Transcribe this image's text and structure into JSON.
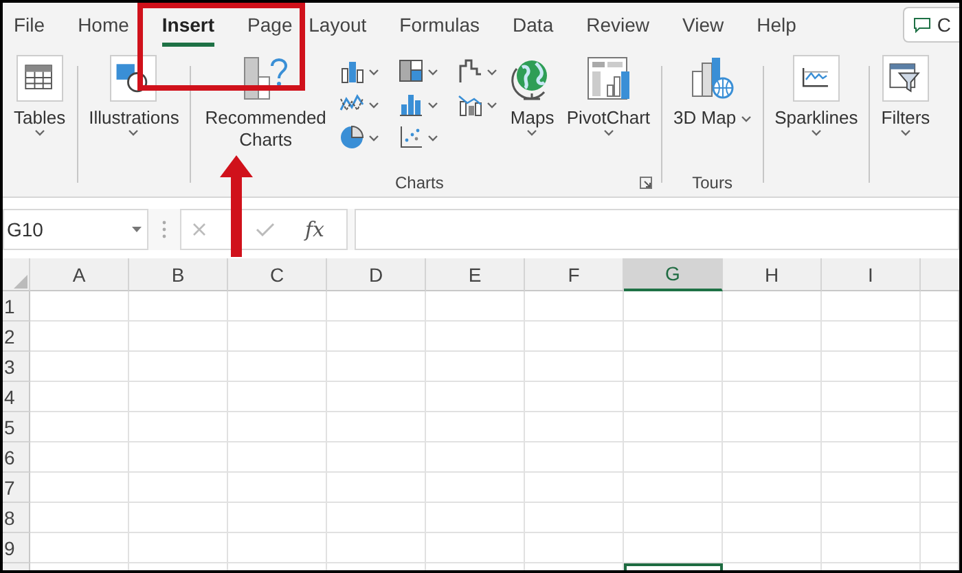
{
  "tabs": [
    {
      "label": "File",
      "selected": false
    },
    {
      "label": "Home",
      "selected": false
    },
    {
      "label": "Insert",
      "selected": true
    },
    {
      "label": "Page Layout",
      "selected": false
    },
    {
      "label": "Formulas",
      "selected": false
    },
    {
      "label": "Data",
      "selected": false
    },
    {
      "label": "Review",
      "selected": false
    },
    {
      "label": "View",
      "selected": false
    },
    {
      "label": "Help",
      "selected": false
    }
  ],
  "comments_button": {
    "label": "C"
  },
  "ribbon": {
    "groups": [
      {
        "launcher": false,
        "items": [
          {
            "kind": "large",
            "label": "Tables",
            "dropdown": true,
            "framed": true
          }
        ]
      },
      {
        "launcher": false,
        "items": [
          {
            "kind": "large",
            "label": "Illustrations",
            "dropdown": true,
            "framed": true
          }
        ]
      },
      {
        "label": "Charts",
        "launcher": true,
        "items": [
          {
            "kind": "large",
            "label": "Recommended Charts",
            "dropdown": false,
            "framed": false
          },
          {
            "kind": "gallery"
          },
          {
            "kind": "large",
            "label": "Maps",
            "dropdown": true,
            "framed": false
          },
          {
            "kind": "large",
            "label": "PivotChart",
            "dropdown": true,
            "framed": false
          }
        ]
      },
      {
        "label": "Tours",
        "launcher": false,
        "items": [
          {
            "kind": "wrapped",
            "label": "3D Map",
            "dropdown": true,
            "framed": false
          }
        ]
      },
      {
        "launcher": false,
        "items": [
          {
            "kind": "large",
            "label": "Sparklines",
            "dropdown": true,
            "framed": true
          }
        ]
      },
      {
        "launcher": false,
        "items": [
          {
            "kind": "large",
            "label": "Filters",
            "dropdown": true,
            "framed": true
          }
        ]
      }
    ]
  },
  "formula_bar": {
    "name_box": "G10",
    "function_label": "fx"
  },
  "sheet": {
    "columns": [
      {
        "label": "A",
        "selected": false
      },
      {
        "label": "B",
        "selected": false
      },
      {
        "label": "C",
        "selected": false
      },
      {
        "label": "D",
        "selected": false
      },
      {
        "label": "E",
        "selected": false
      },
      {
        "label": "F",
        "selected": false
      },
      {
        "label": "G",
        "selected": true
      },
      {
        "label": "H",
        "selected": false
      },
      {
        "label": "I",
        "selected": false
      }
    ],
    "rows": [
      {
        "label": "1"
      },
      {
        "label": "2"
      },
      {
        "label": "3"
      },
      {
        "label": "4"
      },
      {
        "label": "5"
      },
      {
        "label": "6"
      },
      {
        "label": "7"
      },
      {
        "label": "8"
      },
      {
        "label": "9"
      }
    ]
  }
}
